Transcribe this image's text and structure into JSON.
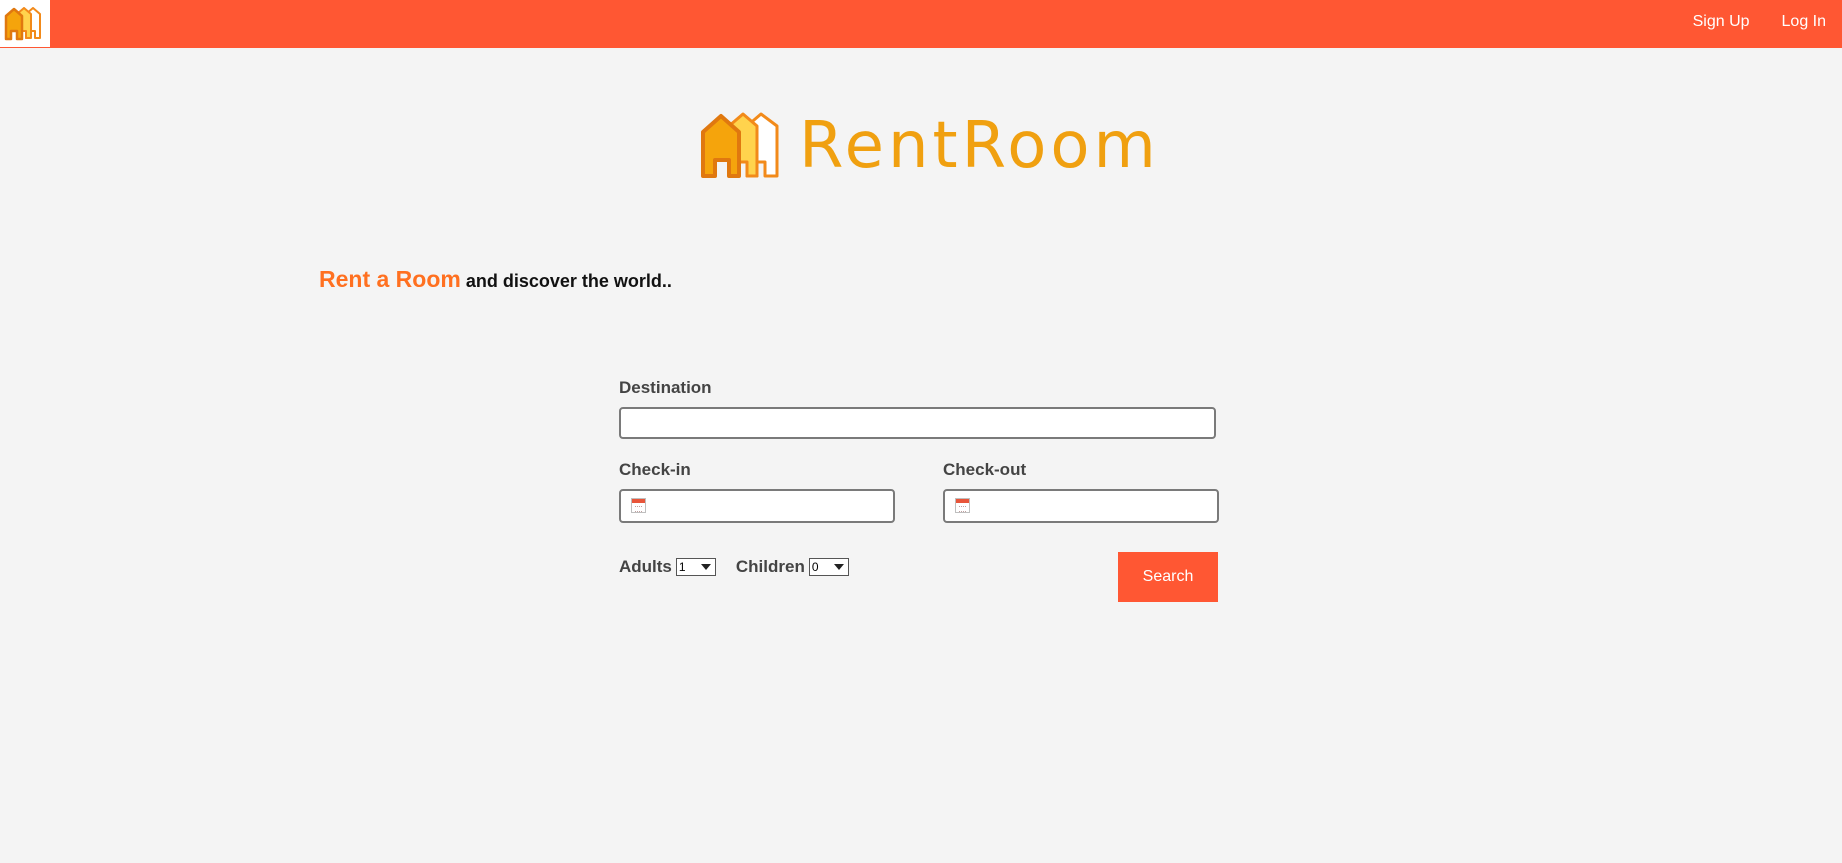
{
  "topbar": {
    "logo_icon": "houses-logo-icon",
    "sign_up_label": "Sign Up",
    "log_in_label": "Log In",
    "color": "#ff5733"
  },
  "brand": {
    "icon": "houses-logo-icon",
    "name": "RentRoom",
    "color": "#f0a010"
  },
  "tagline": {
    "accent": "Rent a Room",
    "rest": "and discover the world.."
  },
  "search_form": {
    "destination": {
      "label": "Destination",
      "value": "",
      "placeholder": ""
    },
    "check_in": {
      "label": "Check-in",
      "value": "",
      "icon": "calendar-icon"
    },
    "check_out": {
      "label": "Check-out",
      "value": "",
      "icon": "calendar-icon"
    },
    "adults": {
      "label": "Adults",
      "selected": "1"
    },
    "children": {
      "label": "Children",
      "selected": "0"
    },
    "search_label": "Search"
  }
}
